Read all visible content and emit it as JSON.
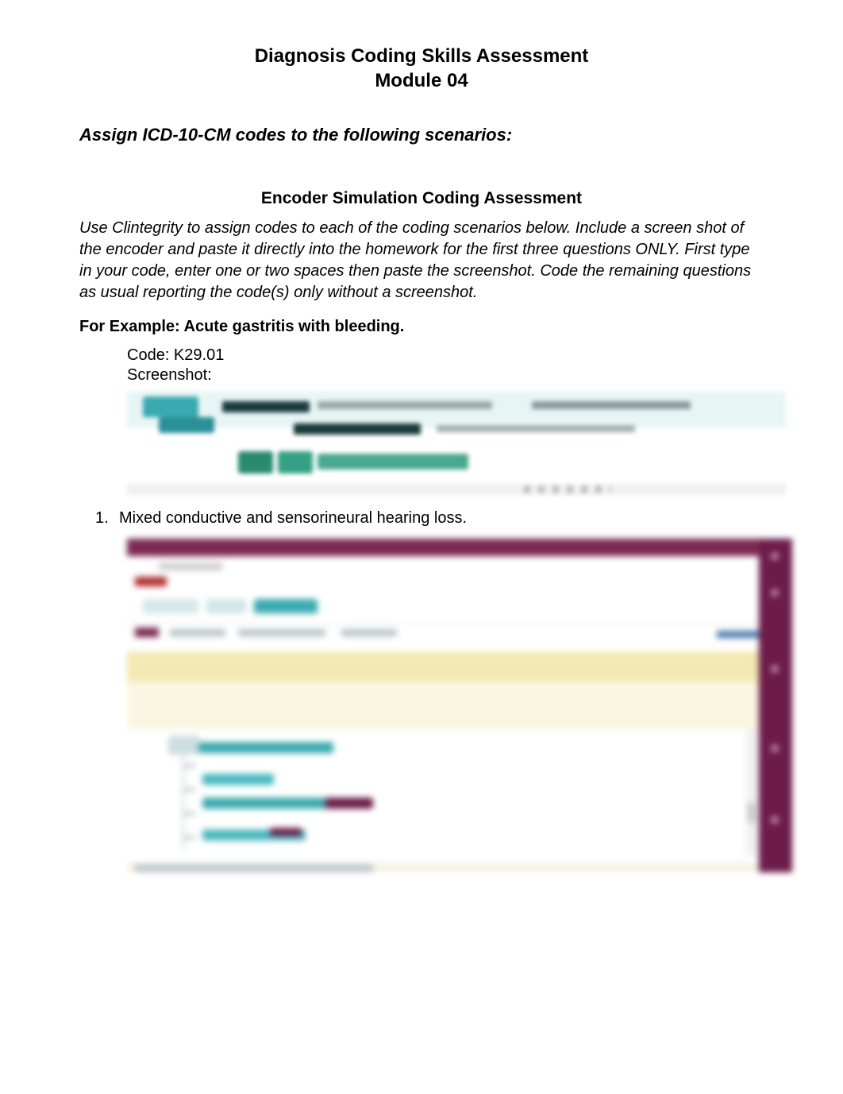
{
  "header": {
    "title_line1": "Diagnosis Coding Skills Assessment",
    "title_line2": "Module 04"
  },
  "assign_heading": "Assign ICD-10-CM codes to the following scenarios:",
  "sub_heading": "Encoder Simulation Coding Assessment",
  "instructions": "Use Clintegrity to assign codes to each of the coding scenarios below. Include a screen shot of the encoder and paste it directly into the homework for the first three questions ONLY. First type in your code, enter one or two spaces then paste the screenshot. Code the remaining questions as usual reporting the code(s) only without a screenshot.",
  "example": {
    "heading": "For Example: Acute gastritis with bleeding.",
    "code_label": "Code: K29.01",
    "screenshot_label": "Screenshot:"
  },
  "questions": [
    {
      "num": "1.",
      "text": "Mixed conductive and sensorineural hearing loss."
    }
  ]
}
